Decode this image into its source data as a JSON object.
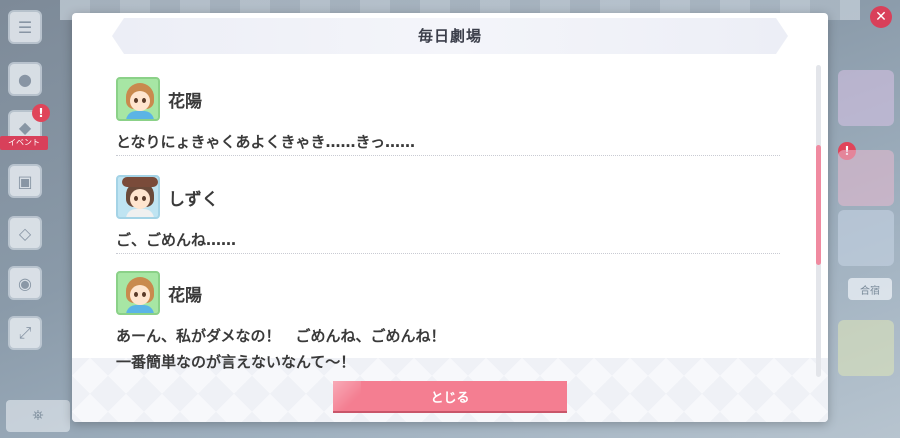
{
  "dialog": {
    "title": "毎日劇場",
    "close_label": "とじる"
  },
  "entries": [
    {
      "name": "花陽",
      "avatar_icon": "hanayo-avatar-icon",
      "lines": [
        "となりにょきゃくあよくきゃき……きっ……"
      ]
    },
    {
      "name": "しずく",
      "avatar_icon": "shizuku-avatar-icon",
      "lines": [
        "ご、ごめんね……"
      ]
    },
    {
      "name": "花陽",
      "avatar_icon": "hanayo-avatar-icon",
      "lines": [
        "あーん、私がダメなの！　ごめんね、ごめんね！",
        "一番簡単なのが言えないなんて～！"
      ]
    }
  ],
  "background": {
    "event_tag": "イベント",
    "right_label": "合宿"
  },
  "colors": {
    "accent_pink": "#f47e91",
    "scroll_thumb": "#f08aa0",
    "title_text": "#3b3e4a",
    "body_text": "#3a3a3a"
  }
}
